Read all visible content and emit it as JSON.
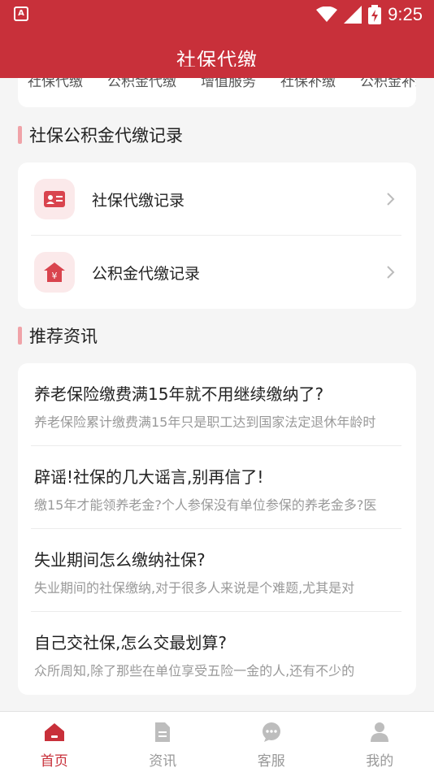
{
  "status_bar": {
    "time": "9:25"
  },
  "header": {
    "title": "社保代缴"
  },
  "top_tabs": [
    "社保代缴",
    "公积金代缴",
    "增值服务",
    "社保补缴",
    "公积金补缴"
  ],
  "records_section": {
    "title": "社保公积金代缴记录",
    "items": [
      {
        "label": "社保代缴记录",
        "icon": "id-card-icon"
      },
      {
        "label": "公积金代缴记录",
        "icon": "house-yuan-icon"
      }
    ]
  },
  "news_section": {
    "title": "推荐资讯",
    "items": [
      {
        "title": "养老保险缴费满15年就不用继续缴纳了?",
        "summary": "养老保险累计缴费满15年只是职工达到国家法定退休年龄时"
      },
      {
        "title": "辟谣!社保的几大谣言,别再信了!",
        "summary": "缴15年才能领养老金?个人参保没有单位参保的养老金多?医"
      },
      {
        "title": "失业期间怎么缴纳社保?",
        "summary": "失业期间的社保缴纳,对于很多人来说是个难题,尤其是对"
      },
      {
        "title": "自己交社保,怎么交最划算?",
        "summary": "众所周知,除了那些在单位享受五险一金的人,还有不少的"
      }
    ]
  },
  "tab_bar": {
    "items": [
      {
        "label": "首页",
        "icon": "home-icon",
        "active": true
      },
      {
        "label": "资讯",
        "icon": "document-icon",
        "active": false
      },
      {
        "label": "客服",
        "icon": "chat-icon",
        "active": false
      },
      {
        "label": "我的",
        "icon": "user-icon",
        "active": false
      }
    ]
  },
  "colors": {
    "brand": "#c8303a",
    "accent_light": "#fbe9ea",
    "section_bar": "#f0a3a8"
  }
}
